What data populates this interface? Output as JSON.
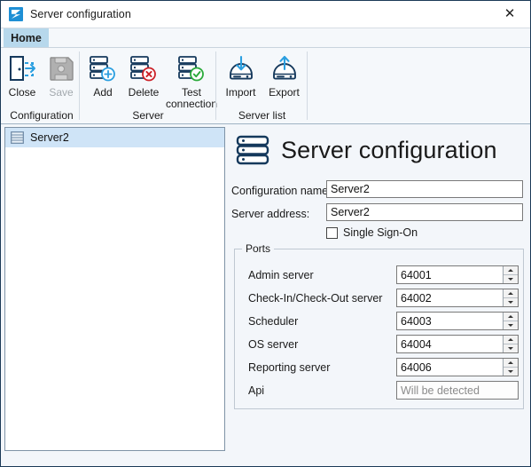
{
  "window": {
    "title": "Server configuration",
    "app_icon": "app-logo-icon",
    "close_label": "✕"
  },
  "ribbon": {
    "tabs": [
      {
        "label": "Home",
        "active": true
      }
    ],
    "groups": [
      {
        "label": "Configuration",
        "buttons": [
          {
            "label": "Close",
            "icon": "exit-door-icon",
            "enabled": true
          },
          {
            "label": "Save",
            "icon": "floppy-disk-icon",
            "enabled": false
          }
        ]
      },
      {
        "label": "Server",
        "buttons": [
          {
            "label": "Add",
            "icon": "server-add-icon",
            "enabled": true
          },
          {
            "label": "Delete",
            "icon": "server-delete-icon",
            "enabled": true
          },
          {
            "label": "Test\nconnection",
            "label_line1": "Test",
            "label_line2": "connection",
            "icon": "server-check-icon",
            "enabled": true
          }
        ]
      },
      {
        "label": "Server list",
        "buttons": [
          {
            "label": "Import",
            "icon": "import-drive-icon",
            "enabled": true
          },
          {
            "label": "Export",
            "icon": "export-drive-icon",
            "enabled": true
          }
        ]
      }
    ]
  },
  "server_list": {
    "items": [
      {
        "label": "Server2",
        "icon": "server-icon",
        "selected": true
      }
    ]
  },
  "detail": {
    "heading": "Server configuration",
    "heading_icon": "server-stack-icon",
    "fields": [
      {
        "label": "Configuration name:",
        "value": "Server2"
      },
      {
        "label": "Server address:",
        "value": "Server2"
      }
    ],
    "checkbox": {
      "label": "Single Sign-On",
      "checked": false
    },
    "ports": {
      "title": "Ports",
      "rows": [
        {
          "label": "Admin server",
          "value": "64001",
          "spinner": true,
          "placeholder": false
        },
        {
          "label": "Check-In/Check-Out server",
          "value": "64002",
          "spinner": true,
          "placeholder": false
        },
        {
          "label": "Scheduler",
          "value": "64003",
          "spinner": true,
          "placeholder": false
        },
        {
          "label": "OS server",
          "value": "64004",
          "spinner": true,
          "placeholder": false
        },
        {
          "label": "Reporting server",
          "value": "64006",
          "spinner": true,
          "placeholder": false
        },
        {
          "label": "Api",
          "value": "Will be detected",
          "spinner": false,
          "placeholder": true
        }
      ]
    }
  },
  "colors": {
    "accent_blue": "#1e8fd5",
    "tab_active": "#b7d8ec",
    "selection": "#cfe4f7",
    "icon_navy": "#15395c",
    "ok_green": "#2aaa3a",
    "error_red": "#cc2229",
    "panel_bg": "#f3f6fa"
  }
}
